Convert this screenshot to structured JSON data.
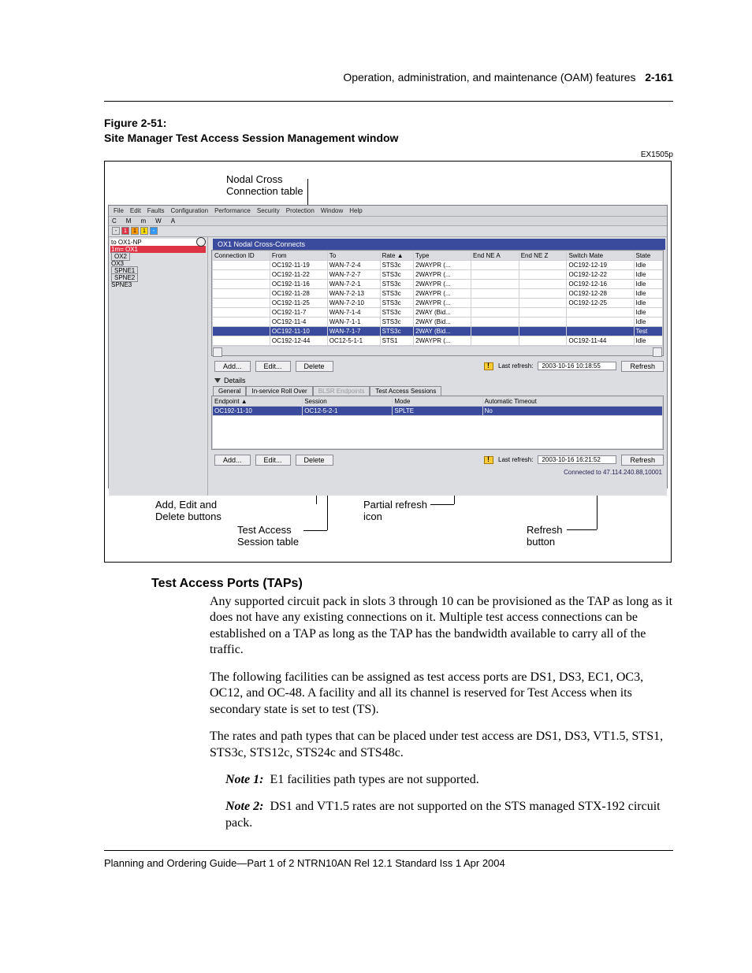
{
  "header": {
    "chapter": "Operation, administration, and maintenance (OAM) features",
    "pageNumber": "2-161"
  },
  "figure": {
    "number": "Figure 2-51:",
    "title": "Site Manager Test Access Session Management window",
    "code": "EX1505p",
    "callouts": {
      "crossConn": "Nodal Cross\nConnection table",
      "addEdit": "Add, Edit and\nDelete buttons",
      "testSess": "Test Access\nSession table",
      "partial": "Partial refresh\nicon",
      "refresh": "Refresh\nbutton"
    }
  },
  "app": {
    "menus": [
      "File",
      "Edit",
      "Faults",
      "Configuration",
      "Performance",
      "Security",
      "Protection",
      "Window",
      "Help"
    ],
    "alarmLetters": [
      "C",
      "M",
      "m",
      "W",
      "A"
    ],
    "alarmBoxes": [
      "-",
      "1",
      "1",
      "1",
      "-"
    ],
    "titleBar": "OX1 Nodal Cross-Connects",
    "tree": [
      {
        "t": "to OX1-NP",
        "style": "sel"
      },
      {
        "t": "OX1",
        "style": "redrow",
        "sev": "1m="
      },
      {
        "t": "OX2",
        "style": "boxrow"
      },
      {
        "t": "OX3",
        "style": ""
      },
      {
        "t": "SPNE1",
        "style": "boxrow"
      },
      {
        "t": "SPNE2",
        "style": "boxrow"
      },
      {
        "t": "SPNE3",
        "style": ""
      }
    ],
    "tableHeaders": [
      "Connection ID",
      "From",
      "To",
      "Rate ▲",
      "Type",
      "End NE A",
      "End NE Z",
      "Switch Mate",
      "State"
    ],
    "tableRows": [
      {
        "c": [
          "",
          "OC192-11-19",
          "WAN-7-2-4",
          "STS3c",
          "2WAYPR (...",
          "",
          "",
          "OC192-12-19",
          "Idle"
        ]
      },
      {
        "c": [
          "",
          "OC192-11-22",
          "WAN-7-2-7",
          "STS3c",
          "2WAYPR (...",
          "",
          "",
          "OC192-12-22",
          "Idle"
        ]
      },
      {
        "c": [
          "",
          "OC192-11-16",
          "WAN-7-2-1",
          "STS3c",
          "2WAYPR (...",
          "",
          "",
          "OC192-12-16",
          "Idle"
        ]
      },
      {
        "c": [
          "",
          "OC192-11-28",
          "WAN-7-2-13",
          "STS3c",
          "2WAYPR (...",
          "",
          "",
          "OC192-12-28",
          "Idle"
        ]
      },
      {
        "c": [
          "",
          "OC192-11-25",
          "WAN-7-2-10",
          "STS3c",
          "2WAYPR (...",
          "",
          "",
          "OC192-12-25",
          "Idle"
        ]
      },
      {
        "c": [
          "",
          "OC192-11-7",
          "WAN-7-1-4",
          "STS3c",
          "2WAY (Bid...",
          "",
          "",
          "",
          "Idle"
        ]
      },
      {
        "c": [
          "",
          "OC192-11-4",
          "WAN-7-1-1",
          "STS3c",
          "2WAY (Bid...",
          "",
          "",
          "",
          "Idle"
        ]
      },
      {
        "c": [
          "",
          "OC192-11-10",
          "WAN-7-1-7",
          "STS3c",
          "2WAY (Bid...",
          "",
          "",
          "",
          "Test"
        ],
        "sel": true
      },
      {
        "c": [
          "",
          "OC192-12-44",
          "OC12-5-1-1",
          "STS1",
          "2WAYPR (...",
          "",
          "",
          "OC192-11-44",
          "Idle"
        ]
      }
    ],
    "btns": {
      "add": "Add...",
      "edit": "Edit...",
      "del": "Delete",
      "lastRef": "Last refresh:",
      "ref": "Refresh"
    },
    "upperRefresh": "2003-10-16 10:18:55",
    "details": "Details",
    "tabs": [
      "General",
      "In-service Roll Over",
      "BLSR Endpoints",
      "Test Access Sessions"
    ],
    "sessHeaders": [
      "Endpoint ▲",
      "Session",
      "Mode",
      "Automatic Timeout"
    ],
    "sessRow": [
      "OC192-11-10",
      "OC12-5-2-1",
      "SPLTE",
      "No"
    ],
    "lowerRefresh": "2003-10-16 16:21:52",
    "status": "Connected to 47.114.240.88,10001"
  },
  "section": {
    "heading": "Test Access Ports (TAPs)",
    "p1": "Any supported circuit pack in slots 3 through 10 can be provisioned as the TAP as long as it does not have any existing connections on it. Multiple test access connections can be established on a TAP as long as the TAP has the bandwidth available to carry all of the traffic.",
    "p2": "The following facilities can be assigned as test access ports are DS1, DS3, EC1, OC3, OC12, and OC-48. A facility and all its channel is reserved for Test Access when its secondary state is set to test (TS).",
    "p3": "The rates and path types that can be placed under test access are DS1, DS3, VT1.5, STS1, STS3c, STS12c, STS24c and STS48c.",
    "note1_label": "Note 1:",
    "note1": "E1 facilities path types are not supported.",
    "note2_label": "Note 2:",
    "note2": "DS1 and VT1.5 rates are not supported on the STS managed STX-192 circuit pack."
  },
  "footer": "Planning and Ordering Guide—Part 1 of 2   NTRN10AN   Rel 12.1   Standard   Iss 1   Apr 2004"
}
